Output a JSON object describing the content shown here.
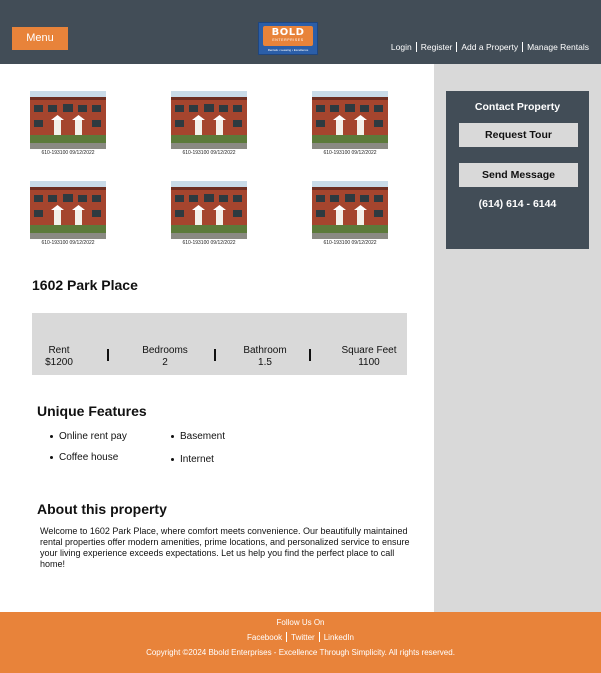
{
  "header": {
    "menu_label": "Menu",
    "logo": {
      "wordmark": "BOLD",
      "subtitle": "ENTERPRISES",
      "tagline": "Rentals • Leasing • Excellence"
    },
    "nav": [
      "Login",
      "Register",
      "Add a Property",
      "Manage Rentals"
    ]
  },
  "photos": [
    {
      "caption": "610-193100 09/12/2022"
    },
    {
      "caption": "610-193100 09/12/2022"
    },
    {
      "caption": "610-193100 09/12/2022"
    },
    {
      "caption": "610-193100 09/12/2022"
    },
    {
      "caption": "610-193100 09/12/2022"
    },
    {
      "caption": "610-193100 09/12/2022"
    }
  ],
  "property": {
    "title": "1602 Park Place",
    "stats": [
      {
        "label": "Rent",
        "value": "$1200"
      },
      {
        "label": "Bedrooms",
        "value": "2"
      },
      {
        "label": "Bathroom",
        "value": "1.5"
      },
      {
        "label": "Square Feet",
        "value": "1100"
      }
    ],
    "features_title": "Unique Features",
    "features": [
      "Online rent pay",
      "Coffee house",
      "Basement",
      "Internet"
    ],
    "about_title": "About this property",
    "about_text": "Welcome to 1602 Park Place, where comfort meets convenience. Our beautifully maintained rental properties offer modern amenities, prime locations, and personalized service to ensure your living experience exceeds expectations. Let us help you find the perfect place to call home!"
  },
  "contact": {
    "title": "Contact Property",
    "request_tour_label": "Request Tour",
    "send_message_label": "Send Message",
    "phone": "(614) 614 - 6144"
  },
  "footer": {
    "follow_label": "Follow Us On",
    "social": [
      "Facebook",
      "Twitter",
      "LinkedIn"
    ],
    "copyright": "Copyright ©2024 Bbold Enterprises - Excellence Through Simplicity. All rights reserved."
  },
  "colors": {
    "header_bg": "#424d57",
    "accent": "#e8833a",
    "panel_bg": "#d9d9d9"
  }
}
